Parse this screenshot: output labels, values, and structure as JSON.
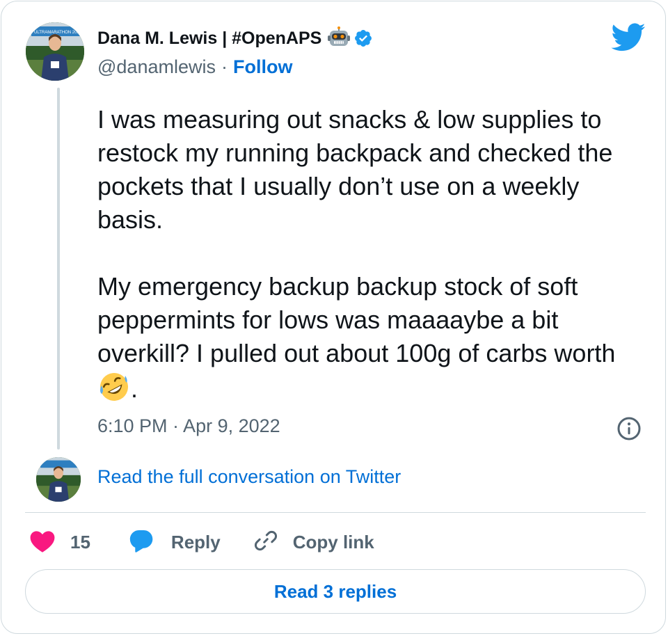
{
  "author": {
    "display_name": "Dana M. Lewis | #OpenAPS",
    "handle": "@danamlewis",
    "separator": "·",
    "follow_label": "Follow",
    "avatar_banner_text": "ULTRAMARATHON 2022"
  },
  "tweet": {
    "paragraphs": [
      "I was measuring out snacks & low supplies to restock my running backpack and checked the pockets that I usually don’t use on a weekly basis.",
      "My emergency backup backup stock of soft peppermints for lows was maaaaybe a bit overkill? I pulled out about 100g of carbs worth"
    ],
    "trailing_text": ".",
    "timestamp": "6:10 PM · Apr 9, 2022"
  },
  "conversation": {
    "read_full_label": "Read the full conversation on Twitter"
  },
  "actions": {
    "like_count": "15",
    "reply_label": "Reply",
    "copy_link_label": "Copy link"
  },
  "replies_button_label": "Read 3 replies",
  "icons": {
    "bird": "twitter-bird-icon",
    "verified": "verified-badge-icon",
    "robot": "robot-emoji-icon",
    "laugh": "rolling-on-floor-laughing-emoji-icon",
    "info": "info-icon",
    "heart": "heart-icon",
    "reply": "speech-bubble-icon",
    "link": "link-icon"
  },
  "colors": {
    "link_blue": "#006fd6",
    "twitter_blue": "#1d9bf0",
    "heart_pink": "#f91880",
    "secondary_text": "#536471",
    "border": "#cfd9de"
  }
}
